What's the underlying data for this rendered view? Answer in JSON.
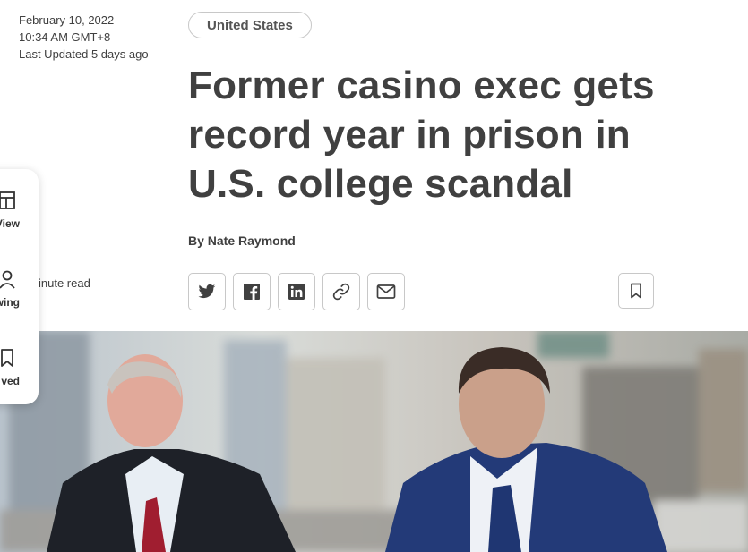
{
  "meta": {
    "date": "February 10, 2022",
    "time": "10:34 AM GMT+8",
    "updated": "Last Updated 5 days ago",
    "read_time": "inute read"
  },
  "panel": {
    "items": [
      {
        "label": "View",
        "icon": "layout-icon"
      },
      {
        "label": "owing",
        "icon": "person-icon"
      },
      {
        "label": "ved",
        "icon": "bookmark-icon"
      }
    ]
  },
  "article": {
    "tag": "United States",
    "headline_lines": [
      "Former casino exec gets",
      "record year in prison in",
      "U.S. college scandal"
    ],
    "byline": "By Nate Raymond"
  },
  "share": {
    "icons": [
      "twitter-icon",
      "facebook-icon",
      "linkedin-icon",
      "link-icon",
      "email-icon"
    ],
    "save_icon": "bookmark-icon"
  },
  "colors": {
    "text": "#404040",
    "border": "#c8c8c8",
    "background": "#ffffff",
    "suit_navy": "#233a78",
    "tie_blue": "#1f3672",
    "tie_red": "#a01e30"
  }
}
